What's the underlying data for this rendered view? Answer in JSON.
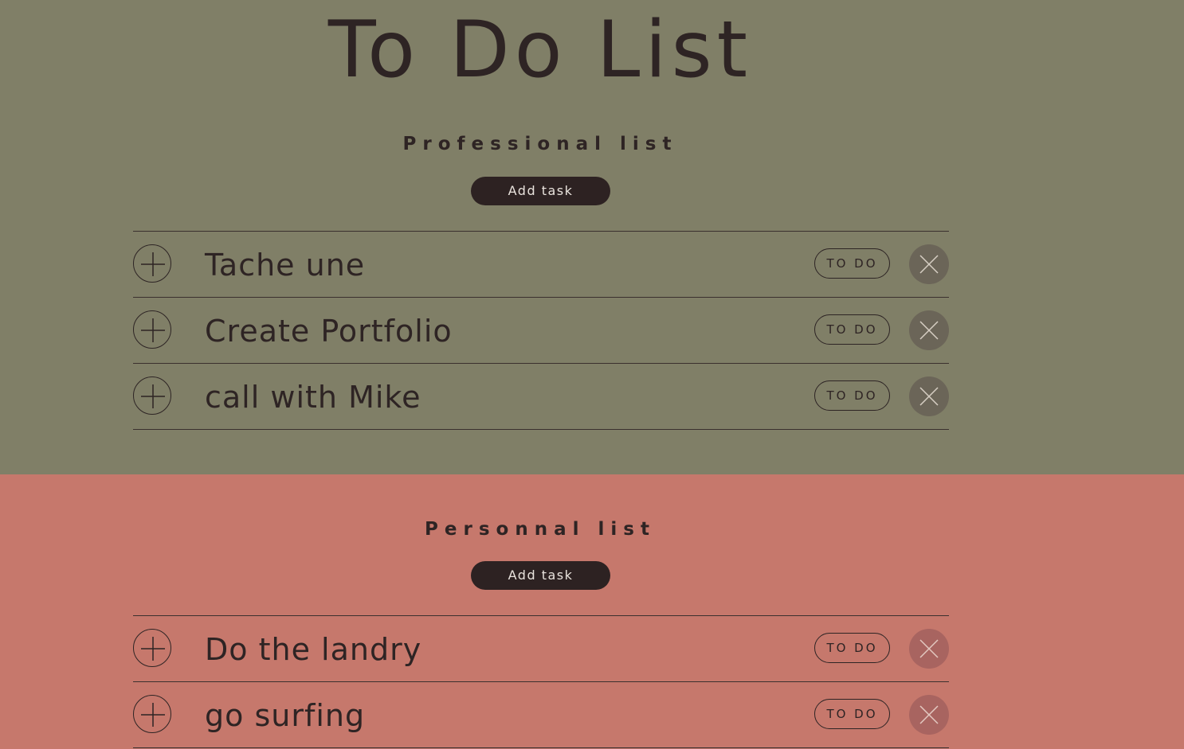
{
  "app": {
    "title": "To Do List"
  },
  "professional": {
    "title": "Professional list",
    "add_label": "Add task",
    "tasks": [
      {
        "name": "Tache une",
        "status": "TO DO"
      },
      {
        "name": "Create Portfolio",
        "status": "TO DO"
      },
      {
        "name": "call with Mike",
        "status": "TO DO"
      }
    ]
  },
  "personal": {
    "title": "Personnal list",
    "add_label": "Add task",
    "tasks": [
      {
        "name": "Do the landry",
        "status": "TO DO"
      },
      {
        "name": "go surfing",
        "status": "TO DO"
      }
    ]
  },
  "icons": {
    "expand": "plus-icon",
    "delete": "close-icon"
  },
  "colors": {
    "professional_bg": "#807f67",
    "personal_bg": "#c6786c",
    "button_bg": "#2d2222",
    "text": "#2e2424"
  }
}
